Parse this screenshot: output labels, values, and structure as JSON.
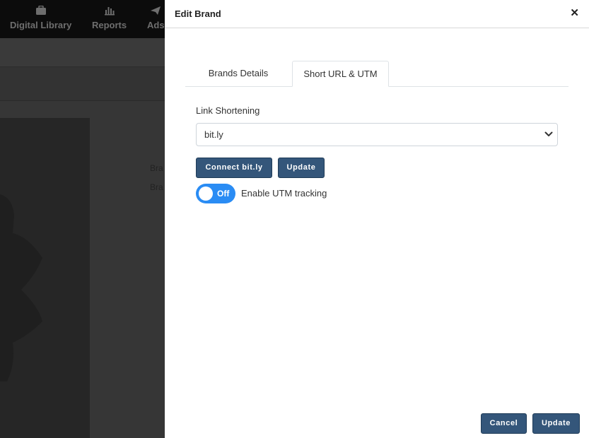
{
  "nav": {
    "items": [
      {
        "label": "Digital Library",
        "icon": "briefcase-icon"
      },
      {
        "label": "Reports",
        "icon": "bar-chart-icon"
      },
      {
        "label": "Ads",
        "icon": "paper-plane-icon"
      }
    ]
  },
  "background": {
    "text1": "Bra",
    "text2": "Bra"
  },
  "drawer": {
    "title": "Edit Brand",
    "close_icon": "close-icon",
    "tabs": [
      {
        "label": "Brands Details",
        "active": false
      },
      {
        "label": "Short URL & UTM",
        "active": true
      }
    ],
    "link_shortening": {
      "label": "Link Shortening",
      "selected": "bit.ly"
    },
    "connect_label": "Connect bit.ly",
    "update_label": "Update",
    "utm": {
      "toggle_state": "Off",
      "label": "Enable UTM tracking"
    },
    "footer": {
      "cancel_label": "Cancel",
      "update_label": "Update"
    }
  },
  "colors": {
    "primary_button": "#34567a",
    "toggle": "#2a8cf4"
  }
}
